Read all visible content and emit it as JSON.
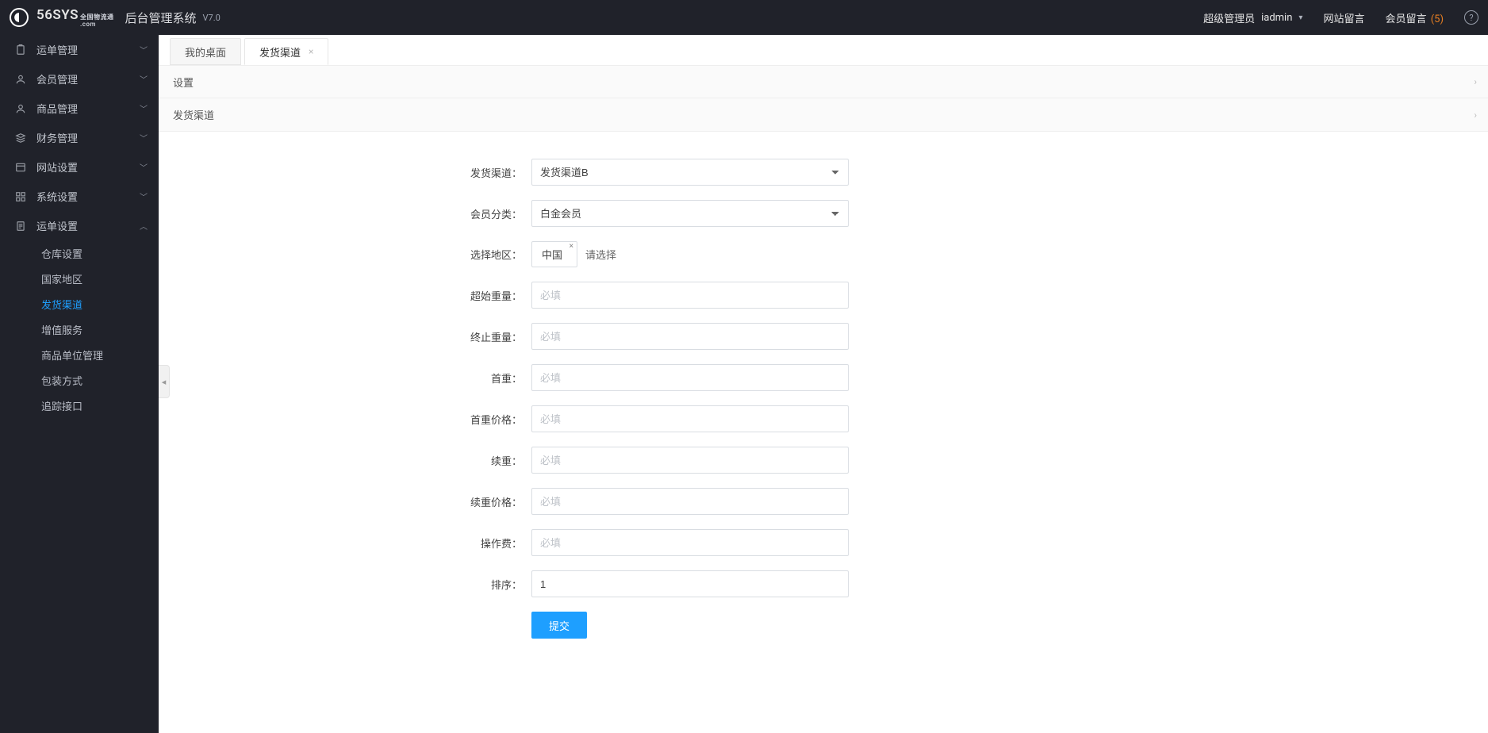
{
  "brand": {
    "name": "56SYS",
    "tld": ".com",
    "sub_cn": "全国物流通"
  },
  "app": {
    "title": "后台管理系统",
    "version": "V7.0"
  },
  "topbar": {
    "role": "超级管理员",
    "user": "iadmin",
    "site_msg_label": "网站留言",
    "member_msg_label": "会员留言",
    "member_msg_count": "(5)"
  },
  "sidebar": {
    "groups": [
      {
        "label": "运单管理"
      },
      {
        "label": "会员管理"
      },
      {
        "label": "商品管理"
      },
      {
        "label": "财务管理"
      },
      {
        "label": "网站设置"
      },
      {
        "label": "系统设置"
      },
      {
        "label": "运单设置"
      }
    ],
    "order_settings_children": [
      {
        "label": "仓库设置"
      },
      {
        "label": "国家地区"
      },
      {
        "label": "发货渠道"
      },
      {
        "label": "增值服务"
      },
      {
        "label": "商品单位管理"
      },
      {
        "label": "包装方式"
      },
      {
        "label": "追踪接口"
      }
    ]
  },
  "tabs": [
    {
      "label": "我的桌面",
      "closable": false,
      "active": false
    },
    {
      "label": "发货渠道",
      "closable": true,
      "active": true
    }
  ],
  "section_bars": [
    {
      "label": "设置"
    },
    {
      "label": "发货渠道"
    }
  ],
  "form": {
    "shipping_channel_label": "发货渠道：",
    "shipping_channel_value": "发货渠道B",
    "member_type_label": "会员分类：",
    "member_type_value": "白金会员",
    "region_label": "选择地区：",
    "region_selected": "中国",
    "region_hint": "请选择",
    "start_weight_label": "超始重量：",
    "start_weight_placeholder": "必填",
    "end_weight_label": "终止重量：",
    "end_weight_placeholder": "必填",
    "first_weight_label": "首重：",
    "first_weight_placeholder": "必填",
    "first_price_label": "首重价格：",
    "first_price_placeholder": "必填",
    "cont_weight_label": "续重：",
    "cont_weight_placeholder": "必填",
    "cont_price_label": "续重价格：",
    "cont_price_placeholder": "必填",
    "handling_fee_label": "操作费：",
    "handling_fee_placeholder": "必填",
    "order_label": "排序：",
    "order_value": "1",
    "submit_label": "提交"
  }
}
